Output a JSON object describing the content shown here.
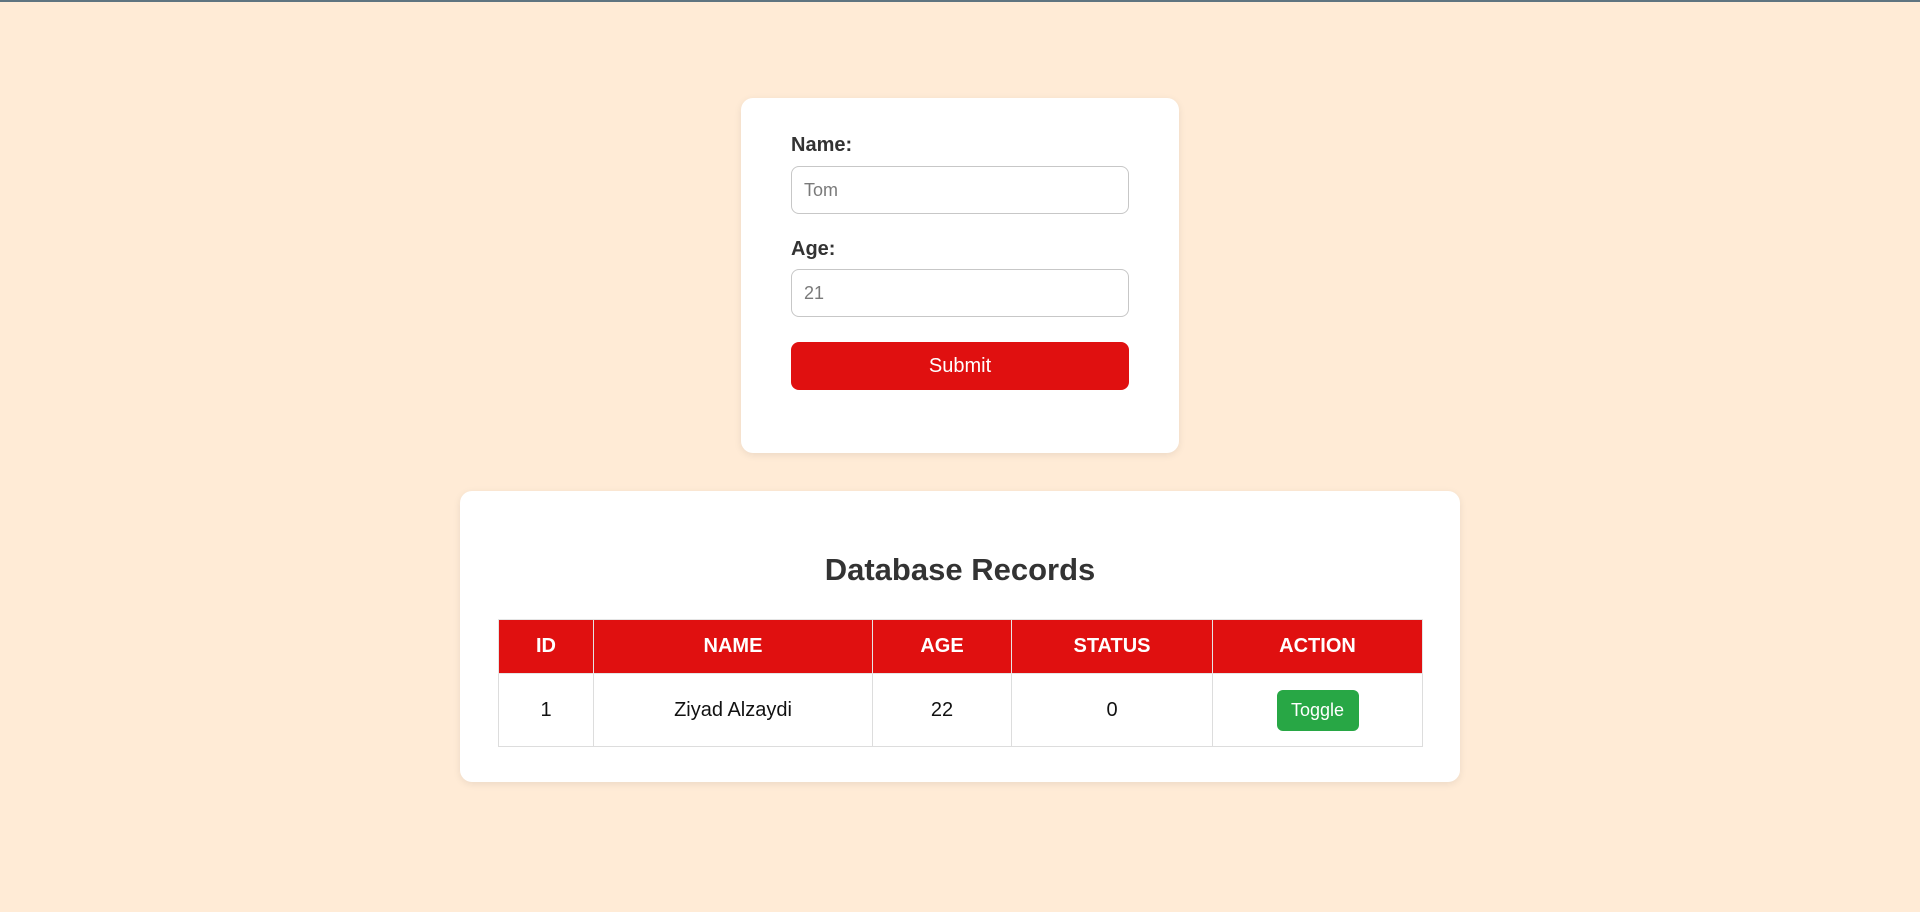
{
  "form": {
    "name_label": "Name:",
    "name_placeholder": "Tom",
    "age_label": "Age:",
    "age_placeholder": "21",
    "submit_label": "Submit"
  },
  "records": {
    "title": "Database Records",
    "columns": [
      "ID",
      "NAME",
      "AGE",
      "STATUS",
      "ACTION"
    ],
    "rows": [
      {
        "id": "1",
        "name": "Ziyad Alzaydi",
        "age": "22",
        "status": "0",
        "action_label": "Toggle"
      }
    ]
  },
  "colors": {
    "background": "#ffebd6",
    "accent": "#e01010",
    "toggle": "#28a745"
  }
}
